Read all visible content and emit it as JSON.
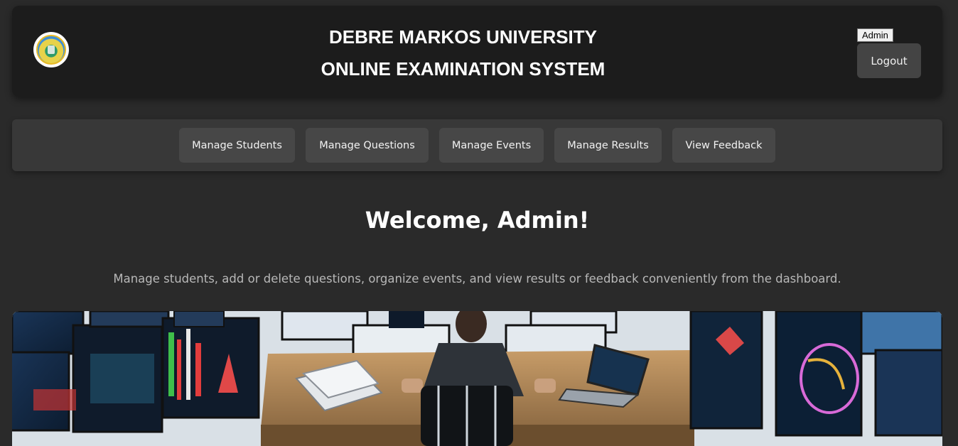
{
  "header": {
    "title_line1": "DEBRE MARKOS UNIVERSITY",
    "title_line2": "ONLINE EXAMINATION SYSTEM",
    "user_tag": "Admin",
    "logout_label": "Logout",
    "logo_icon": "university-seal-icon"
  },
  "nav": {
    "items": [
      {
        "label": "Manage Students"
      },
      {
        "label": "Manage Questions"
      },
      {
        "label": "Manage Events"
      },
      {
        "label": "Manage Results"
      },
      {
        "label": "View Feedback"
      }
    ]
  },
  "main": {
    "welcome": "Welcome, Admin!",
    "description": "Manage students, add or delete questions, organize events, and view results or feedback conveniently from the dashboard."
  },
  "colors": {
    "page_bg": "#2a2a2a",
    "header_bg": "#1c1c1c",
    "nav_bg": "#383838",
    "button_bg": "#474747"
  }
}
